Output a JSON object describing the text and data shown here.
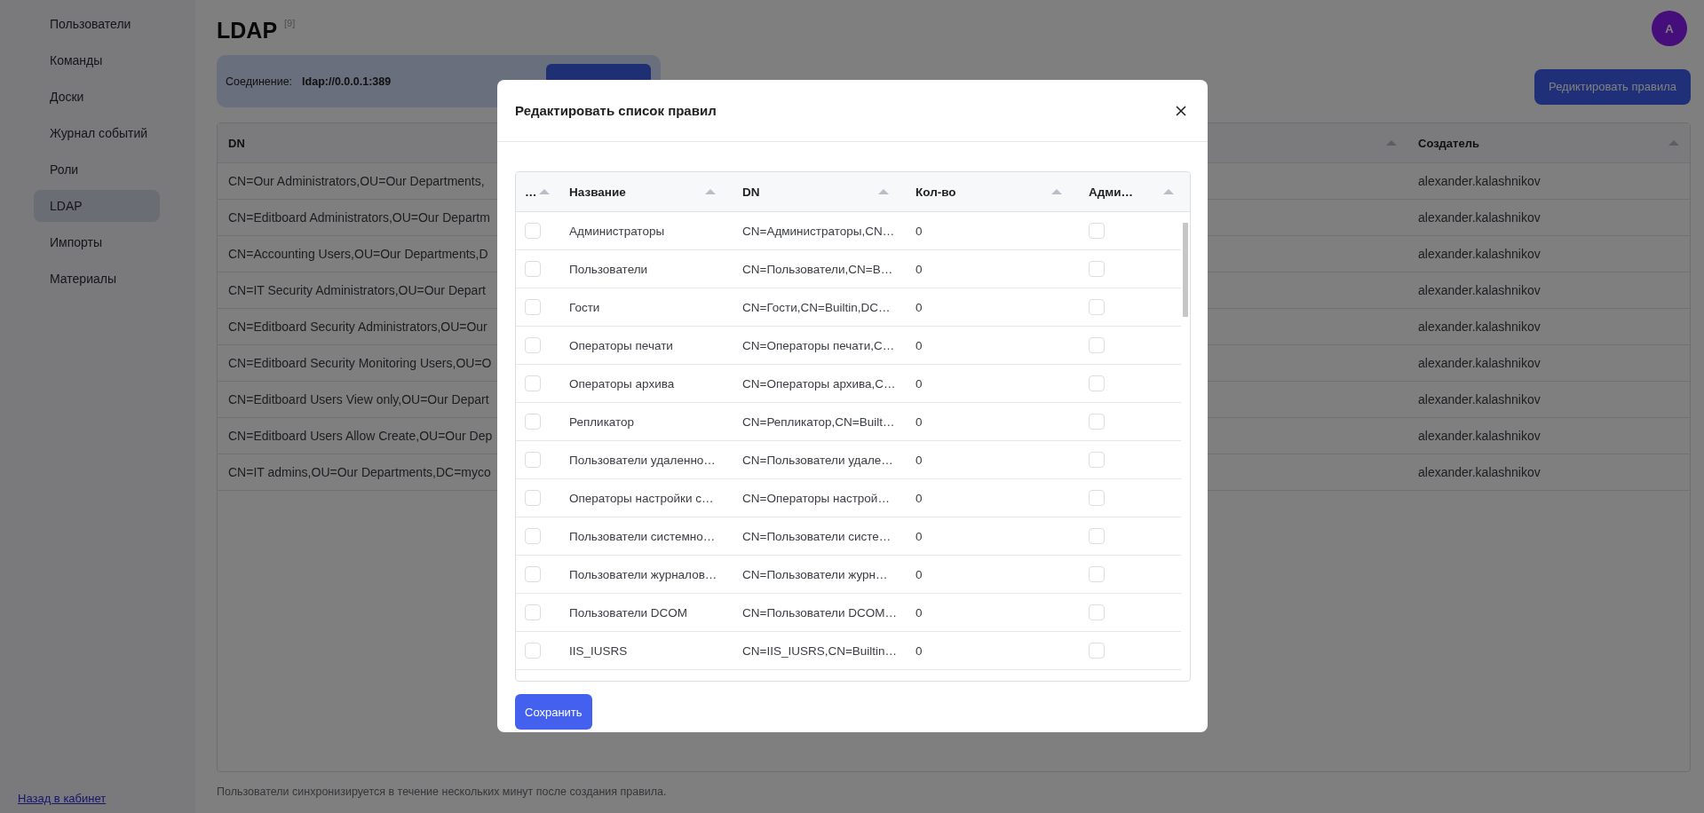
{
  "sidebar": {
    "items": [
      {
        "label": "Пользователи",
        "selected": false
      },
      {
        "label": "Команды",
        "selected": false
      },
      {
        "label": "Доски",
        "selected": false
      },
      {
        "label": "Журнал событий",
        "selected": false
      },
      {
        "label": "Роли",
        "selected": false
      },
      {
        "label": "LDAP",
        "selected": true
      },
      {
        "label": "Импорты",
        "selected": false
      },
      {
        "label": "Материалы",
        "selected": false
      }
    ],
    "back_link": "Назад в кабинет"
  },
  "header": {
    "title": "LDAP",
    "count": "[9]",
    "avatar": "A"
  },
  "connection": {
    "label": "Соединение:",
    "value": "ldap://0.0.0.1:389"
  },
  "edit_rules_button": "Редиктировать правила",
  "rules_table": {
    "columns": [
      "DN",
      "Создатель"
    ],
    "rows": [
      {
        "dn": "CN=Our Administrators,OU=Our Departments,",
        "creator": "alexander.kalashnikov"
      },
      {
        "dn": "CN=Editboard Administrators,OU=Our Departm",
        "creator": "alexander.kalashnikov"
      },
      {
        "dn": "CN=Accounting Users,OU=Our Departments,D",
        "creator": "alexander.kalashnikov"
      },
      {
        "dn": "CN=IT Security Administrators,OU=Our Depart",
        "creator": "alexander.kalashnikov"
      },
      {
        "dn": "CN=Editboard Security Administrators,OU=Our",
        "creator": "alexander.kalashnikov"
      },
      {
        "dn": "CN=Editboard Security Monitoring Users,OU=O",
        "creator": "alexander.kalashnikov"
      },
      {
        "dn": "CN=Editboard Users View only,OU=Our Depart",
        "creator": "alexander.kalashnikov"
      },
      {
        "dn": "CN=Editboard Users Allow Create,OU=Our Dep",
        "creator": "alexander.kalashnikov"
      },
      {
        "dn": "CN=IT admins,OU=Our Departments,DC=myco",
        "creator": "alexander.kalashnikov"
      }
    ]
  },
  "note": "Пользователи синхронизируется в течение нескольких минут после создания правила.",
  "modal": {
    "title": "Редактировать список правил",
    "columns": [
      "…",
      "Название",
      "DN",
      "Кол-во",
      "Адми…"
    ],
    "rows": [
      {
        "selected": false,
        "name": "Администраторы",
        "dn": "CN=Администраторы,CN…",
        "count": "0",
        "admin": false
      },
      {
        "selected": false,
        "name": "Пользователи",
        "dn": "CN=Пользователи,CN=B…",
        "count": "0",
        "admin": false
      },
      {
        "selected": false,
        "name": "Гости",
        "dn": "CN=Гости,CN=Builtin,DC…",
        "count": "0",
        "admin": false
      },
      {
        "selected": false,
        "name": "Операторы печати",
        "dn": "CN=Операторы печати,C…",
        "count": "0",
        "admin": false
      },
      {
        "selected": false,
        "name": "Операторы архива",
        "dn": "CN=Операторы архива,C…",
        "count": "0",
        "admin": false
      },
      {
        "selected": false,
        "name": "Репликатор",
        "dn": "CN=Репликатор,CN=Built…",
        "count": "0",
        "admin": false
      },
      {
        "selected": false,
        "name": "Пользователи удаленно…",
        "dn": "CN=Пользователи удале…",
        "count": "0",
        "admin": false
      },
      {
        "selected": false,
        "name": "Операторы настройки с…",
        "dn": "CN=Операторы настрой…",
        "count": "0",
        "admin": false
      },
      {
        "selected": false,
        "name": "Пользователи системно…",
        "dn": "CN=Пользователи систе…",
        "count": "0",
        "admin": false
      },
      {
        "selected": false,
        "name": "Пользователи журналов…",
        "dn": "CN=Пользователи журн…",
        "count": "0",
        "admin": false
      },
      {
        "selected": false,
        "name": "Пользователи DCOM",
        "dn": "CN=Пользователи DCOM…",
        "count": "0",
        "admin": false
      },
      {
        "selected": false,
        "name": "IIS_IUSRS",
        "dn": "CN=IIS_IUSRS,CN=Builtin…",
        "count": "0",
        "admin": false
      }
    ],
    "save_button": "Сохранить"
  }
}
